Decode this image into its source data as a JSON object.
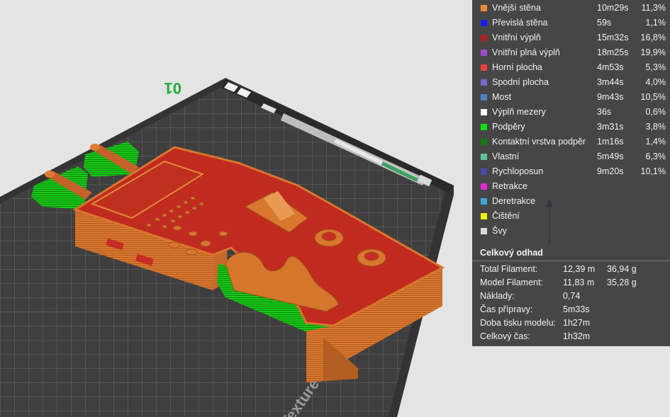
{
  "plate": {
    "number": "01",
    "texture_label": "Textured"
  },
  "legend": [
    {
      "name": "Vnější stěna",
      "time": "10m29s",
      "percent": "11,3%",
      "color": "#f08a3c"
    },
    {
      "name": "Převislá stěna",
      "time": "59s",
      "percent": "1,1%",
      "color": "#1a1aff"
    },
    {
      "name": "Vnitřní výplň",
      "time": "15m32s",
      "percent": "16,8%",
      "color": "#b02020"
    },
    {
      "name": "Vnitřní plná výplň",
      "time": "18m25s",
      "percent": "19,9%",
      "color": "#9c4fd0"
    },
    {
      "name": "Horní plocha",
      "time": "4m53s",
      "percent": "5,3%",
      "color": "#e84040"
    },
    {
      "name": "Spodní plocha",
      "time": "3m44s",
      "percent": "4,0%",
      "color": "#7b68c8"
    },
    {
      "name": "Most",
      "time": "9m43s",
      "percent": "10,5%",
      "color": "#4d80c0"
    },
    {
      "name": "Výplň mezery",
      "time": "36s",
      "percent": "0,6%",
      "color": "#ffffff"
    },
    {
      "name": "Podpěry",
      "time": "3m31s",
      "percent": "3,8%",
      "color": "#10e010"
    },
    {
      "name": "Kontaktní vrstva podpěr",
      "time": "1m16s",
      "percent": "1,4%",
      "color": "#107a10"
    },
    {
      "name": "Vlastní",
      "time": "5m49s",
      "percent": "6,3%",
      "color": "#5fc49a"
    },
    {
      "name": "Rychloposun",
      "time": "9m20s",
      "percent": "10,1%",
      "color": "#4a4aa8"
    },
    {
      "name": "Retrakce",
      "time": "",
      "percent": "",
      "color": "#e02ad0"
    },
    {
      "name": "Deretrakce",
      "time": "",
      "percent": "",
      "color": "#3fa5d8"
    },
    {
      "name": "Čištění",
      "time": "",
      "percent": "",
      "color": "#f2f200"
    },
    {
      "name": "Švy",
      "time": "",
      "percent": "",
      "color": "#dcdcdc"
    }
  ],
  "summary": {
    "title": "Celkový odhad",
    "rows": [
      {
        "label": "Total Filament:",
        "value": "12,39 m",
        "value2": "36,94 g"
      },
      {
        "label": "Model Filament:",
        "value": "11,83 m",
        "value2": "35,28 g"
      },
      {
        "label": "Náklady:",
        "value": "0,74",
        "value2": ""
      },
      {
        "label": "Čas přípravy:",
        "value": "5m33s",
        "value2": ""
      },
      {
        "label": "Doba tisku modelu:",
        "value": "1h27m",
        "value2": ""
      },
      {
        "label": "Celkový čas:",
        "value": "1h32m",
        "value2": ""
      }
    ]
  }
}
